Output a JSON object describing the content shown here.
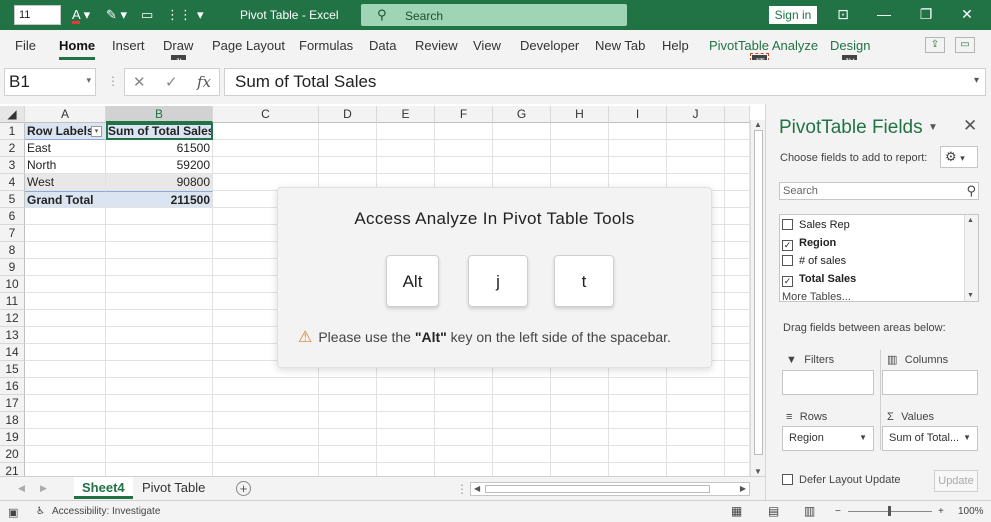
{
  "titlebar": {
    "font_size": "11",
    "title": "Pivot Table  -  Excel",
    "search": "Search",
    "sign_in": "Sign in"
  },
  "ribbon": {
    "tabs": [
      "File",
      "Home",
      "Insert",
      "Draw",
      "Page Layout",
      "Formulas",
      "Data",
      "Review",
      "View",
      "Developer",
      "New Tab",
      "Help",
      "PivotTable Analyze",
      "Design"
    ],
    "keytips": {
      "draw": "JI",
      "pivot_analyze": "JT",
      "design": "JY"
    }
  },
  "formula_bar": {
    "name_box": "B1",
    "formula": "Sum of Total Sales"
  },
  "grid": {
    "columns": [
      "A",
      "B",
      "C",
      "D",
      "E",
      "F",
      "G",
      "H",
      "I",
      "J"
    ],
    "rows": [
      "1",
      "2",
      "3",
      "4",
      "5",
      "6",
      "7",
      "8",
      "9",
      "10",
      "11",
      "12",
      "13",
      "14",
      "15",
      "16",
      "17",
      "18",
      "19",
      "20",
      "21"
    ],
    "pivot": {
      "header": [
        "Row Labels",
        "Sum of Total Sales"
      ],
      "rows": [
        {
          "label": "East",
          "value": "61500"
        },
        {
          "label": "North",
          "value": "59200"
        },
        {
          "label": "West",
          "value": "90800"
        }
      ],
      "total": {
        "label": "Grand Total",
        "value": "211500"
      }
    }
  },
  "sheets": {
    "tabs": [
      "Sheet4",
      "Pivot Table"
    ],
    "active": "Sheet4"
  },
  "status": {
    "accessibility": "Accessibility: Investigate",
    "zoom": "100%"
  },
  "pivot_panel": {
    "title": "PivotTable Fields",
    "choose_label": "Choose fields to add to report:",
    "search_placeholder": "Search",
    "fields": [
      {
        "name": "Sales Rep",
        "checked": false
      },
      {
        "name": "Region",
        "checked": true
      },
      {
        "name": "# of sales",
        "checked": false
      },
      {
        "name": "Total Sales",
        "checked": true
      },
      {
        "name": "More Tables...",
        "checked": null
      }
    ],
    "drag_label": "Drag fields between areas below:",
    "areas": {
      "filters": "Filters",
      "columns": "Columns",
      "rows": "Rows",
      "values": "Values",
      "rows_value": "Region",
      "values_value": "Sum of Total..."
    },
    "defer_label": "Defer Layout Update",
    "update_label": "Update"
  },
  "dialog": {
    "title": "Access Analyze In Pivot Table Tools",
    "keys": [
      "Alt",
      "j",
      "t"
    ],
    "note_prefix": "Please use the ",
    "note_key": "\"Alt\"",
    "note_suffix": " key on the left side of the spacebar."
  },
  "colors": {
    "excel_green": "#217346",
    "pivot_header_blue": "#dbe5f1",
    "warning_orange": "#d9822b"
  }
}
